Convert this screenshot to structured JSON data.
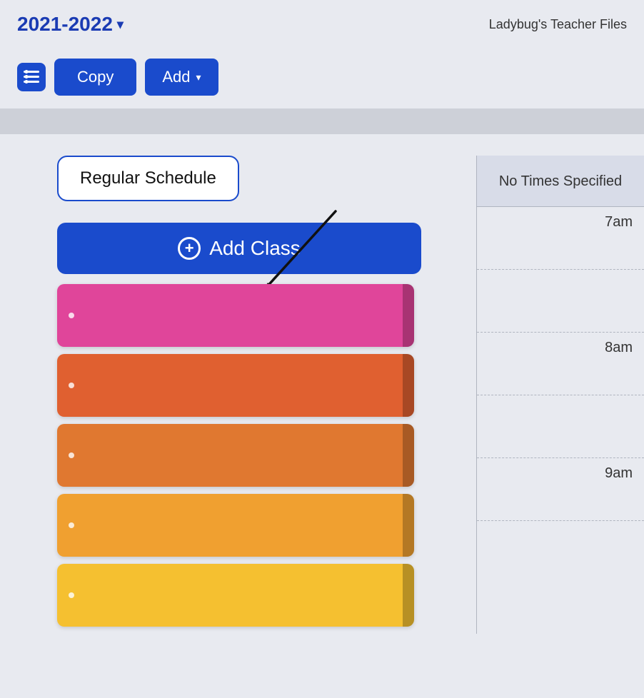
{
  "header": {
    "year": "2021-2022",
    "teacher": "Ladybug's Teacher Files"
  },
  "toolbar": {
    "list_icon": "☰",
    "copy_label": "Copy",
    "add_label": "Add"
  },
  "schedule": {
    "schedule_button_label": "Regular Schedule",
    "add_class_label": "Add Class",
    "classes": [
      {
        "color": "pink",
        "dot": "."
      },
      {
        "color": "orange-dark",
        "dot": "."
      },
      {
        "color": "orange-mid",
        "dot": "."
      },
      {
        "color": "orange-light",
        "dot": "."
      },
      {
        "color": "yellow",
        "dot": "."
      }
    ]
  },
  "times": {
    "header": "No Times Specified",
    "slots": [
      "7am",
      "8am",
      "9am"
    ]
  }
}
